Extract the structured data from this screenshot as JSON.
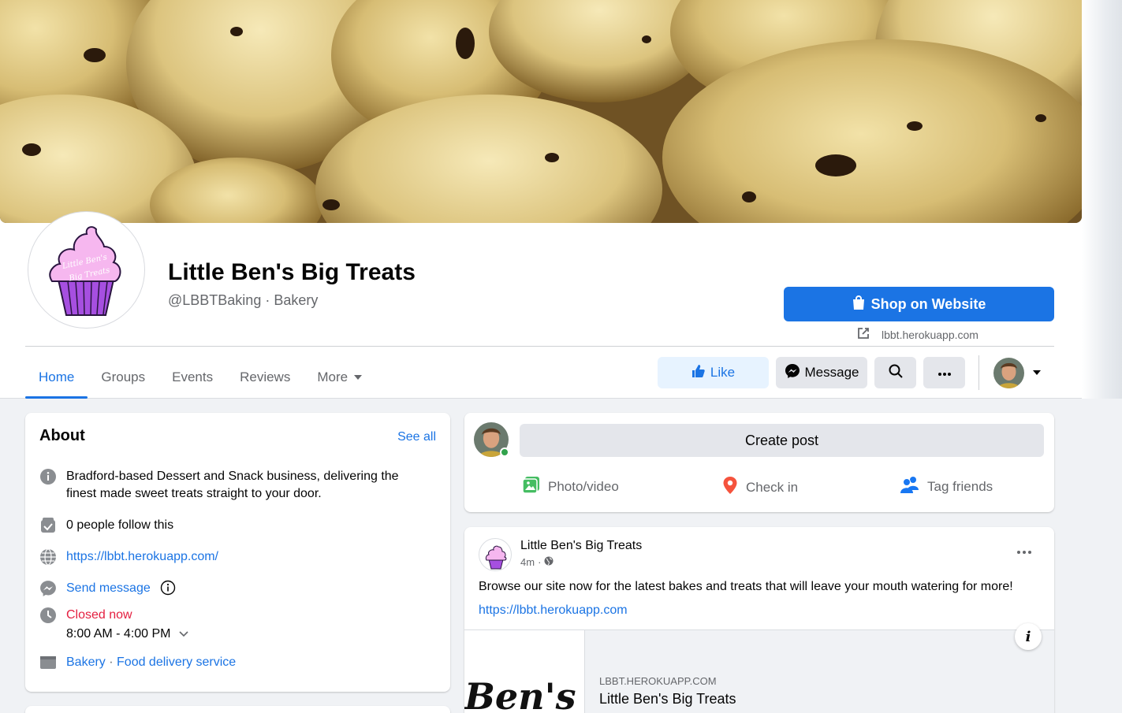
{
  "page": {
    "name": "Little Ben's Big Treats",
    "handle_category": "@LBBTBaking · Bakery"
  },
  "cta": {
    "shop_label": "Shop on Website",
    "website_short": "lbbt.herokuapp.com"
  },
  "tabs": [
    "Home",
    "Groups",
    "Events",
    "Reviews",
    "More"
  ],
  "actions": {
    "like": "Like",
    "message": "Message"
  },
  "about": {
    "title": "About",
    "see_all": "See all",
    "description": "Bradford-based Dessert and Snack business, delivering the finest made sweet treats straight to your door.",
    "followers": "0 people follow this",
    "website": "https://lbbt.herokuapp.com/",
    "send_message": "Send message",
    "status": "Closed now",
    "hours": "8:00 AM - 4:00 PM",
    "category1": "Bakery",
    "category_sep": " · ",
    "category2": "Food delivery service"
  },
  "composer": {
    "create_post": "Create post",
    "photo_video": "Photo/video",
    "check_in": "Check in",
    "tag_friends": "Tag friends"
  },
  "post": {
    "author": "Little Ben's Big Treats",
    "time": "4m",
    "time_sep": "·",
    "text": "Browse our site now for the latest bakes and treats that will leave your mouth watering for more!",
    "link": "https://lbbt.herokuapp.com",
    "preview_domain": "LBBT.HEROKUAPP.COM",
    "preview_title": "Little Ben's Big Treats",
    "preview_logo_text": "Ben's"
  },
  "logo_text": {
    "line1": "Little Ben's",
    "line2": "Big Treats"
  },
  "colors": {
    "accent": "#1b74e4",
    "closed": "#e41e3f",
    "online": "#31a24c"
  }
}
